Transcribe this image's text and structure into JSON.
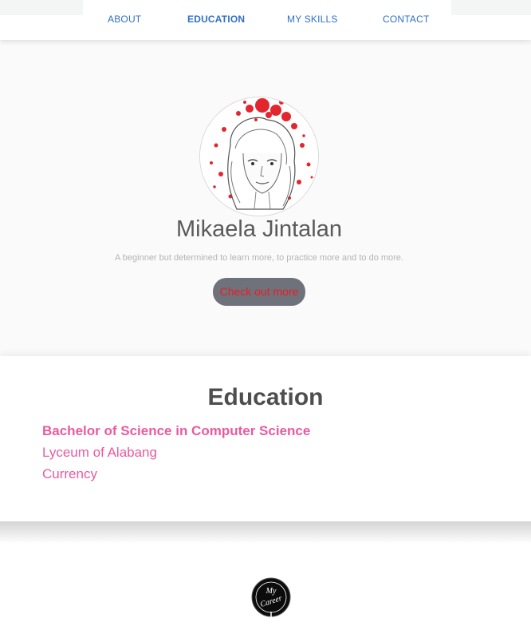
{
  "nav": {
    "items": [
      {
        "label": "ABOUT"
      },
      {
        "label": "EDUCATION"
      },
      {
        "label": "MY SKILLS"
      },
      {
        "label": "CONTACT"
      }
    ],
    "active": "EDUCATION"
  },
  "hero": {
    "name": "Mikaela Jintalan",
    "tagline": "A beginner but determined to learn more, to practice more and to do more.",
    "button_label": "Check out more"
  },
  "education": {
    "title": "Education",
    "degree": "Bachelor of Science in Computer Science",
    "school": "Lyceum of Alabang",
    "status": "Currency"
  },
  "footer": {
    "logo_line1": "My",
    "logo_line2": "Career"
  },
  "colors": {
    "nav_link": "#2f6fc9",
    "accent_pink": "#ea5a9f",
    "button_bg": "#6f727a",
    "button_text": "#ee1b24"
  }
}
